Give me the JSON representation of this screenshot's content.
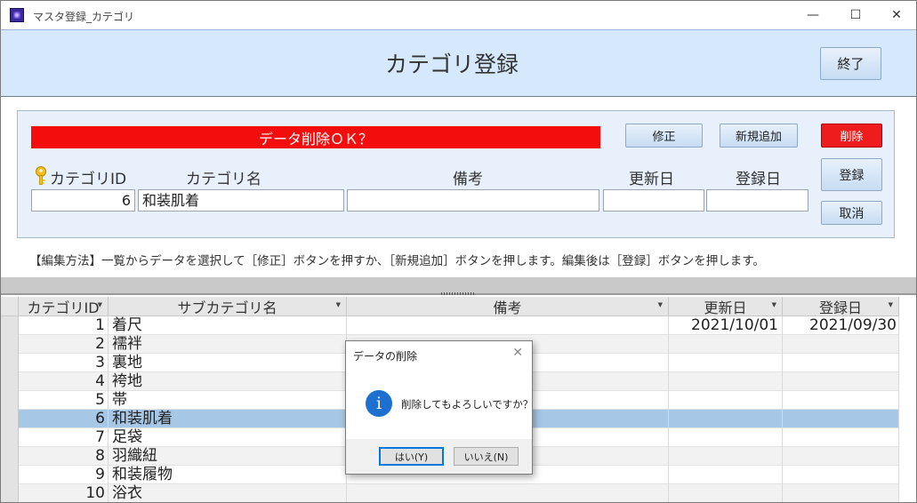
{
  "window": {
    "title": "マスタ登録_カテゴリ",
    "minimize_glyph": "—",
    "maximize_glyph": "☐",
    "close_glyph": "✕"
  },
  "header": {
    "title": "カテゴリ登録",
    "end_button": "終了"
  },
  "form": {
    "alert_text": "データ削除ＯＫ？",
    "alert_color": "#f30d0d",
    "buttons": {
      "edit": "修正",
      "new": "新規追加",
      "delete": "削除",
      "register": "登録",
      "cancel": "取消"
    },
    "labels": {
      "category_id": "カテゴリID",
      "category_name": "カテゴリ名",
      "note": "備考",
      "updated": "更新日",
      "registered": "登録日"
    },
    "values": {
      "category_id": "6",
      "category_name": "和装肌着",
      "note": "",
      "updated": "",
      "registered": ""
    }
  },
  "help_text": "【編集方法】一覧からデータを選択して［修正］ボタンを押すか、［新規追加］ボタンを押します。編集後は［登録］ボタンを押します。",
  "table": {
    "columns": [
      "カテゴリID",
      "サブカテゴリ名",
      "備考",
      "更新日",
      "登録日"
    ],
    "rows": [
      {
        "id": "1",
        "name": "着尺",
        "note": "",
        "updated": "2021/10/01",
        "registered": "2021/09/30"
      },
      {
        "id": "2",
        "name": "襦袢",
        "note": "",
        "updated": "",
        "registered": ""
      },
      {
        "id": "3",
        "name": "裏地",
        "note": "",
        "updated": "",
        "registered": ""
      },
      {
        "id": "4",
        "name": "袴地",
        "note": "",
        "updated": "",
        "registered": ""
      },
      {
        "id": "5",
        "name": "帯",
        "note": "",
        "updated": "",
        "registered": ""
      },
      {
        "id": "6",
        "name": "和装肌着",
        "note": "",
        "updated": "",
        "registered": ""
      },
      {
        "id": "7",
        "name": "足袋",
        "note": "",
        "updated": "",
        "registered": ""
      },
      {
        "id": "8",
        "name": "羽織紐",
        "note": "",
        "updated": "",
        "registered": ""
      },
      {
        "id": "9",
        "name": "和装履物",
        "note": "",
        "updated": "",
        "registered": ""
      },
      {
        "id": "10",
        "name": "浴衣",
        "note": "",
        "updated": "",
        "registered": ""
      }
    ],
    "selected_row": 6
  },
  "dialog": {
    "title": "データの削除",
    "message": "削除してもよろしいですか？",
    "icon_glyph": "i",
    "yes": "はい(Y)",
    "no": "いいえ(N)"
  }
}
